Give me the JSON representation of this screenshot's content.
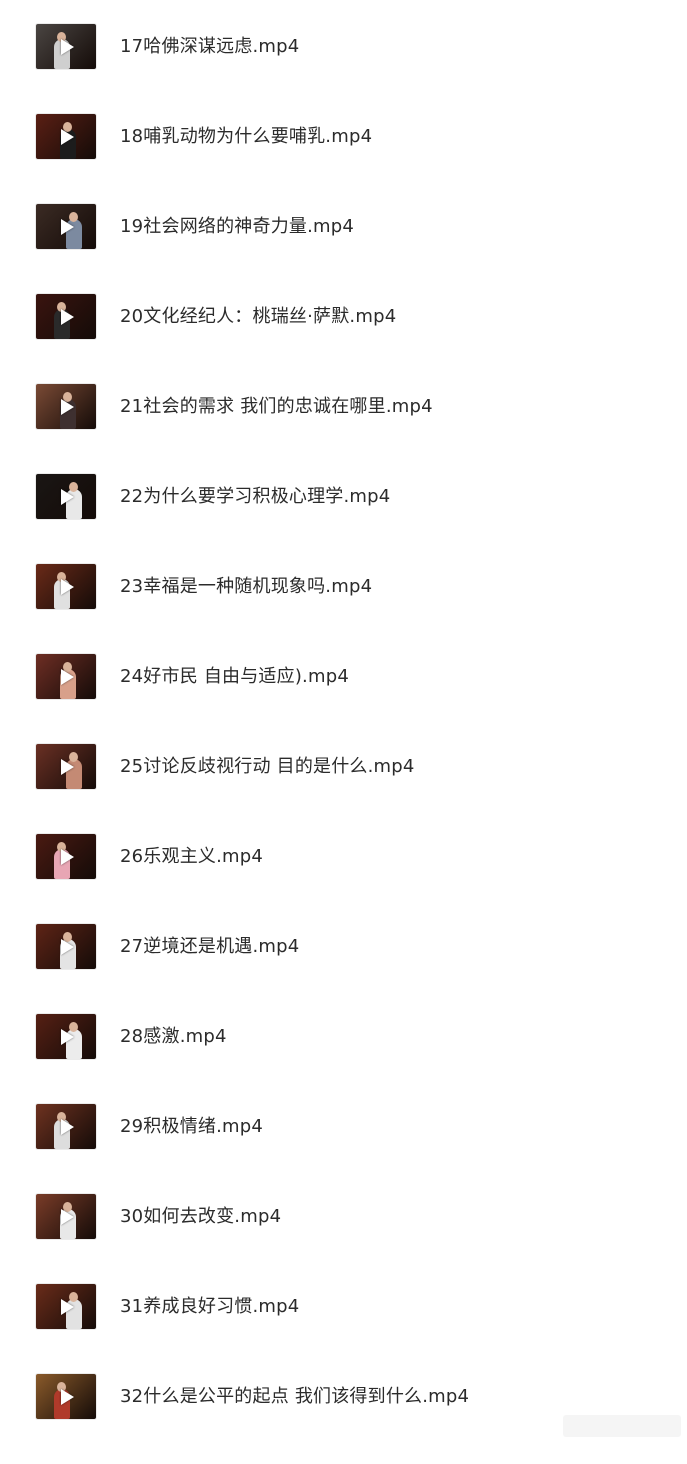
{
  "files": [
    {
      "name": "17哈佛深谋远虑.mp4",
      "thumb_icon": "video-thumbnail-icon",
      "colors": {
        "bg": "#4a4542",
        "figure": "#cfcfcf"
      }
    },
    {
      "name": "18哺乳动物为什么要哺乳.mp4",
      "thumb_icon": "video-thumbnail-icon",
      "colors": {
        "bg": "#5a1f14",
        "figure": "#1c1c1c"
      }
    },
    {
      "name": "19社会网络的神奇力量.mp4",
      "thumb_icon": "video-thumbnail-icon",
      "colors": {
        "bg": "#3b2b24",
        "figure": "#7c8aa0"
      }
    },
    {
      "name": "20文化经纪人：桃瑞丝·萨默.mp4",
      "thumb_icon": "video-thumbnail-icon",
      "colors": {
        "bg": "#3a140f",
        "figure": "#2a2a2a"
      }
    },
    {
      "name": "21社会的需求 我们的忠诚在哪里.mp4",
      "thumb_icon": "video-thumbnail-icon",
      "colors": {
        "bg": "#7a4a35",
        "figure": "#3e3030"
      }
    },
    {
      "name": "22为什么要学习积极心理学.mp4",
      "thumb_icon": "video-thumbnail-icon",
      "colors": {
        "bg": "#1a1614",
        "figure": "#e8e8e8"
      }
    },
    {
      "name": "23幸福是一种随机现象吗.mp4",
      "thumb_icon": "video-thumbnail-icon",
      "colors": {
        "bg": "#6a2a18",
        "figure": "#e0e0e0"
      }
    },
    {
      "name": "24好市民 自由与适应).mp4",
      "thumb_icon": "video-thumbnail-icon",
      "colors": {
        "bg": "#6e2e24",
        "figure": "#d8a08a"
      }
    },
    {
      "name": "25讨论反歧视行动 目的是什么.mp4",
      "thumb_icon": "video-thumbnail-icon",
      "colors": {
        "bg": "#6a3024",
        "figure": "#c48a74"
      }
    },
    {
      "name": "26乐观主义.mp4",
      "thumb_icon": "video-thumbnail-icon",
      "colors": {
        "bg": "#4a1a12",
        "figure": "#e8a6b4"
      }
    },
    {
      "name": "27逆境还是机遇.mp4",
      "thumb_icon": "video-thumbnail-icon",
      "colors": {
        "bg": "#5e2416",
        "figure": "#e4e4e4"
      }
    },
    {
      "name": "28感激.mp4",
      "thumb_icon": "video-thumbnail-icon",
      "colors": {
        "bg": "#562014",
        "figure": "#ececec"
      }
    },
    {
      "name": "29积极情绪.mp4",
      "thumb_icon": "video-thumbnail-icon",
      "colors": {
        "bg": "#6e3220",
        "figure": "#dddddd"
      }
    },
    {
      "name": "30如何去改变.mp4",
      "thumb_icon": "video-thumbnail-icon",
      "colors": {
        "bg": "#7a3c28",
        "figure": "#e8e8e8"
      }
    },
    {
      "name": "31养成良好习惯.mp4",
      "thumb_icon": "video-thumbnail-icon",
      "colors": {
        "bg": "#6a2c1a",
        "figure": "#e2e2e2"
      }
    },
    {
      "name": "32什么是公平的起点 我们该得到什么.mp4",
      "thumb_icon": "video-thumbnail-icon",
      "colors": {
        "bg": "#8a5a2a",
        "figure": "#b03a2a"
      }
    }
  ]
}
